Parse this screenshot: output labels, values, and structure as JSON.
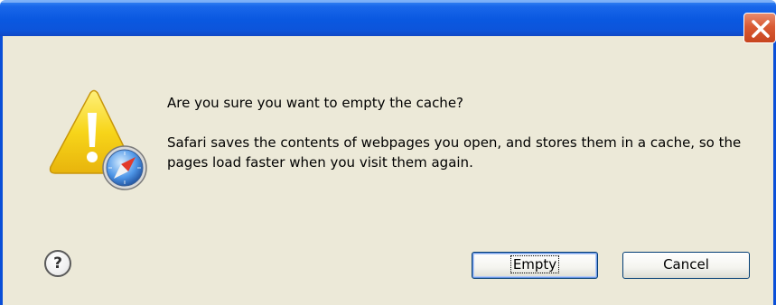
{
  "dialog": {
    "title": "",
    "heading": "Are you sure you want to empty the cache?",
    "body": "Safari saves the contents of webpages you open, and stores them in a cache, so the pages load faster when you visit them again.",
    "icon": "warning-icon",
    "badge_icon": "safari-compass-icon"
  },
  "titlebar": {
    "close_icon": "close-icon"
  },
  "buttons": {
    "help_label": "?",
    "empty_label": "Empty",
    "cancel_label": "Cancel"
  },
  "colors": {
    "titlebar_blue": "#0a58e0",
    "close_red": "#d95a33",
    "dialog_background": "#ece9d8",
    "warning_yellow": "#f7d51a"
  }
}
